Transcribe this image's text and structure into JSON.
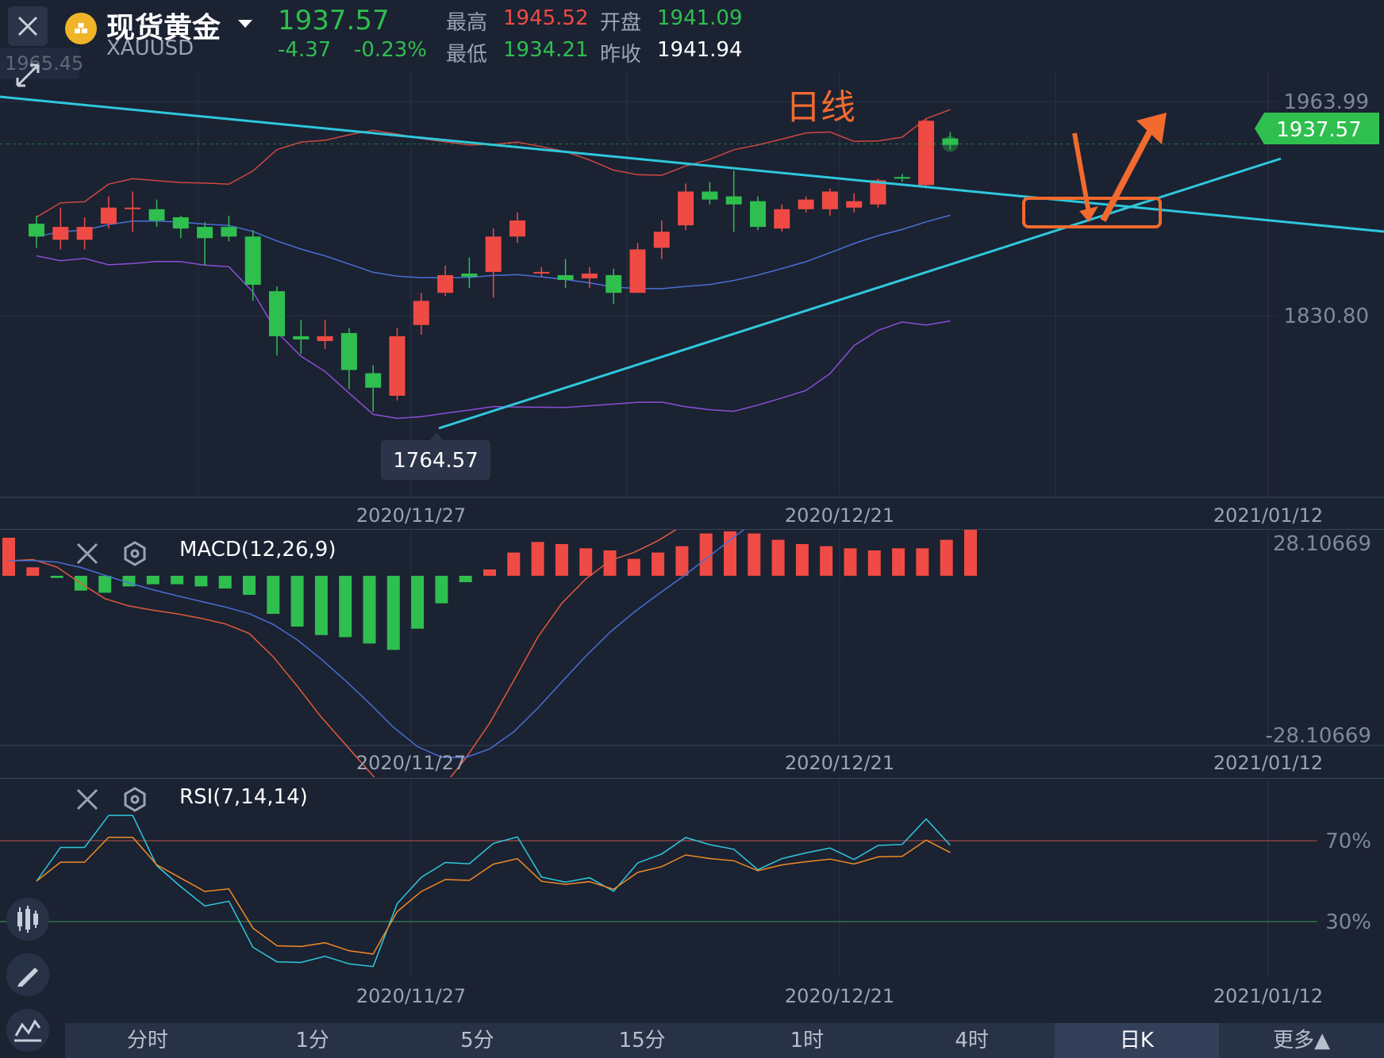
{
  "header": {
    "close_icon": "close-icon",
    "coin_icon": "gold-coin-icon",
    "title": "现货黄金",
    "symbol": "XAUUSD",
    "price": "1937.57",
    "change": "-4.37",
    "change_pct": "-0.23%",
    "high_label": "最高",
    "high_value": "1945.52",
    "low_label": "最低",
    "low_value": "1934.21",
    "open_label": "开盘",
    "open_value": "1941.09",
    "prev_label": "昨收",
    "prev_value": "1941.94",
    "ghost_price": "1965.45"
  },
  "main_chart": {
    "annotation": "日线",
    "price_labels": [
      "1963.99",
      "1830.80"
    ],
    "current_price": "1937.57",
    "low_marker": "1764.57",
    "dates": [
      "2020/11/27",
      "2020/12/21",
      "2021/01/12"
    ]
  },
  "macd": {
    "title": "MACD(12,26,9)",
    "top": "28.10669",
    "bottom": "-28.10669",
    "dates": [
      "2020/11/27",
      "2020/12/21",
      "2021/01/12"
    ]
  },
  "rsi": {
    "title": "RSI(7,14,14)",
    "level_high": "70%",
    "level_low": "30%",
    "dates": [
      "2020/11/27",
      "2020/12/21",
      "2021/01/12"
    ]
  },
  "tabs": [
    "分时",
    "1分",
    "5分",
    "15分",
    "1时",
    "4时",
    "日K",
    "更多▲"
  ],
  "active_tab": "日K",
  "colors": {
    "up": "#ef4b44",
    "down": "#2fbf4f",
    "trend": "#2ec8dc",
    "annot": "#f26a2e"
  },
  "chart_data": [
    {
      "type": "candlestick",
      "title": "日线",
      "y_ticks": [
        1963.99,
        1830.8
      ],
      "current": 1937.57,
      "low_label": 1764.57,
      "x_ticks": [
        "2020/11/27",
        "2020/12/21",
        "2021/01/12"
      ],
      "candles": [
        {
          "o": 1888,
          "c": 1880,
          "h": 1893,
          "l": 1873
        },
        {
          "o": 1878,
          "c": 1886,
          "h": 1898,
          "l": 1872
        },
        {
          "o": 1878,
          "c": 1886,
          "h": 1892,
          "l": 1872
        },
        {
          "o": 1888,
          "c": 1898,
          "h": 1905,
          "l": 1885
        },
        {
          "o": 1898,
          "c": 1898,
          "h": 1908,
          "l": 1883
        },
        {
          "o": 1897,
          "c": 1890,
          "h": 1903,
          "l": 1886
        },
        {
          "o": 1892,
          "c": 1885,
          "h": 1893,
          "l": 1879
        },
        {
          "o": 1886,
          "c": 1879,
          "h": 1889,
          "l": 1862
        },
        {
          "o": 1886,
          "c": 1880,
          "h": 1893,
          "l": 1877
        },
        {
          "o": 1880,
          "c": 1850,
          "h": 1884,
          "l": 1840
        },
        {
          "o": 1846,
          "c": 1818,
          "h": 1849,
          "l": 1806
        },
        {
          "o": 1818,
          "c": 1816,
          "h": 1828,
          "l": 1807
        },
        {
          "o": 1815,
          "c": 1818,
          "h": 1828,
          "l": 1810
        },
        {
          "o": 1820,
          "c": 1797,
          "h": 1823,
          "l": 1785
        },
        {
          "o": 1795,
          "c": 1786,
          "h": 1800,
          "l": 1771
        },
        {
          "o": 1781,
          "c": 1818,
          "h": 1823,
          "l": 1778
        },
        {
          "o": 1825,
          "c": 1840,
          "h": 1845,
          "l": 1819
        },
        {
          "o": 1845,
          "c": 1856,
          "h": 1862,
          "l": 1843
        },
        {
          "o": 1857,
          "c": 1855,
          "h": 1867,
          "l": 1848
        },
        {
          "o": 1858,
          "c": 1880,
          "h": 1885,
          "l": 1842
        },
        {
          "o": 1880,
          "c": 1890,
          "h": 1895,
          "l": 1876
        },
        {
          "o": 1858,
          "c": 1858,
          "h": 1861,
          "l": 1855
        },
        {
          "o": 1856,
          "c": 1853,
          "h": 1866,
          "l": 1848
        },
        {
          "o": 1854,
          "c": 1857,
          "h": 1861,
          "l": 1848
        },
        {
          "o": 1856,
          "c": 1845,
          "h": 1860,
          "l": 1838
        },
        {
          "o": 1845,
          "c": 1872,
          "h": 1876,
          "l": 1845
        },
        {
          "o": 1873,
          "c": 1883,
          "h": 1890,
          "l": 1866
        },
        {
          "o": 1887,
          "c": 1908,
          "h": 1913,
          "l": 1884
        },
        {
          "o": 1908,
          "c": 1903,
          "h": 1914,
          "l": 1900
        },
        {
          "o": 1905,
          "c": 1900,
          "h": 1921,
          "l": 1883
        },
        {
          "o": 1902,
          "c": 1886,
          "h": 1905,
          "l": 1884
        },
        {
          "o": 1885,
          "c": 1897,
          "h": 1900,
          "l": 1883
        },
        {
          "o": 1897,
          "c": 1903,
          "h": 1905,
          "l": 1895
        },
        {
          "o": 1897,
          "c": 1908,
          "h": 1910,
          "l": 1893
        },
        {
          "o": 1898,
          "c": 1902,
          "h": 1907,
          "l": 1895
        },
        {
          "o": 1900,
          "c": 1915,
          "h": 1916,
          "l": 1898
        },
        {
          "o": 1917,
          "c": 1916,
          "h": 1919,
          "l": 1914
        },
        {
          "o": 1912,
          "c": 1952,
          "h": 1953,
          "l": 1910
        },
        {
          "o": 1941,
          "c": 1937,
          "h": 1945,
          "l": 1934
        }
      ]
    },
    {
      "type": "bar",
      "title": "MACD(12,26,9)",
      "ylim": [
        -28.10669,
        28.10669
      ],
      "x_ticks": [
        "2020/11/27",
        "2020/12/21",
        "2021/01/12"
      ],
      "values": [
        9,
        2,
        -0.5,
        -3.5,
        -4,
        -2.5,
        -2,
        -2,
        -2.5,
        -3,
        -4.5,
        -9,
        -12,
        -14,
        -14.5,
        -16,
        -17.5,
        -12.5,
        -6.5,
        -1.5,
        1.5,
        5.5,
        8,
        7.5,
        6.5,
        6,
        4,
        5.5,
        7,
        10,
        10.5,
        10,
        8.5,
        7.5,
        7,
        6.5,
        6,
        6.5,
        6.5,
        8.5,
        11
      ]
    },
    {
      "type": "line",
      "title": "RSI(7,14,14)",
      "ylim": [
        0,
        100
      ],
      "levels": [
        70,
        30
      ],
      "x_ticks": [
        "2020/11/27",
        "2020/12/21",
        "2021/01/12"
      ]
    }
  ]
}
